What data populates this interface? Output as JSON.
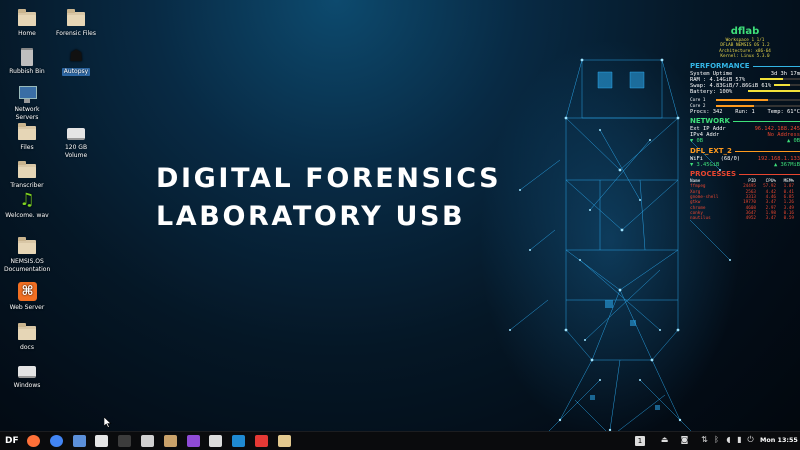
{
  "desktop": {
    "icons": [
      {
        "label": "Home",
        "type": "folder"
      },
      {
        "label": "Forensic Files",
        "type": "folder"
      },
      {
        "label": "Rubbish Bin",
        "type": "trash"
      },
      {
        "label": "Autopsy",
        "type": "app",
        "selected": true
      },
      {
        "label": "Network Servers",
        "type": "network"
      },
      {
        "label": "Files",
        "type": "folder"
      },
      {
        "label": "120 GB Volume",
        "type": "drive"
      },
      {
        "label": "Transcriber",
        "type": "folder"
      },
      {
        "label": "Welcome. wav",
        "type": "audio"
      },
      {
        "label": "NEMSIS.OS Documentation",
        "type": "folder"
      },
      {
        "label": "Web Server",
        "type": "xampp"
      },
      {
        "label": "docs",
        "type": "folder"
      },
      {
        "label": "Windows",
        "type": "drive"
      }
    ]
  },
  "wallpaper": {
    "headline_line1": "DIGITAL FORENSICS",
    "headline_line2": "LABORATORY USB",
    "accent": "#2fb6ff"
  },
  "conky": {
    "title": "dflab",
    "workspace": "Workspace 1 1/1",
    "os": "DFLAB NEMSIS OS 1.2",
    "arch": "Architecture: x86-64",
    "kernel": "Kernel: Linux 5.3.0",
    "performance": {
      "header": "PERFORMANCE",
      "uptime_label": "System Uptime",
      "uptime_value": "3d 3h 17m",
      "ram_label": "RAM : 4.14GiB 57%",
      "ram_pct": 57,
      "swap_label": "Swap: 4.83GiB/7.86GiB 61%",
      "swap_pct": 61,
      "battery_label": "Battery: 100%",
      "battery_pct": 100,
      "core1_label": "Core 1",
      "core1_pct": 62,
      "core2_label": "Core 2",
      "core2_pct": 45,
      "procs": "Procs: 342",
      "run": "Run: 1",
      "temp": "Temp: 61°C"
    },
    "network": {
      "header": "NETWORK",
      "ext_ip_label": "Ext IP Addr",
      "ext_ip_value": "96.142.188.245",
      "ipv4_label": "IPv4 Addr",
      "ipv4_value": "No Address",
      "down": "▼ 0B",
      "up": "▲ 0B"
    },
    "ext": {
      "header": "DFL_EXT_2",
      "wifi_label": "WiFi",
      "wifi_quality": "(68/0)",
      "wifi_ip": "192.168.1.133",
      "down": "▼ 3.45GiB",
      "up": "▲ 367MiB"
    },
    "processes": {
      "header": "PROCESSES",
      "columns": [
        "Name",
        "PID",
        "CPU%",
        "MEM%"
      ],
      "rows": [
        [
          "ffmpeg",
          "24495",
          "57.92",
          "1.87"
        ],
        [
          "Xorg",
          "2563",
          "4.42",
          "0.41"
        ],
        [
          "gnome-shell",
          "3313",
          "4.46",
          "6.85"
        ],
        [
          "gtkw",
          "19770",
          "3.47",
          "1.26"
        ],
        [
          "chrome",
          "4608",
          "2.97",
          "3.49"
        ],
        [
          "conky",
          "3647",
          "1.98",
          "0.16"
        ],
        [
          "nautilus",
          "4952",
          "3.47",
          "0.59"
        ]
      ]
    },
    "colors": {
      "green": "#3ee07a",
      "blue": "#33b5e5",
      "orange": "#ff9a1e",
      "red": "#e8452f",
      "yellow": "#f2e23a"
    }
  },
  "taskbar": {
    "start_label": "DF",
    "apps": [
      "firefox-icon",
      "chrome-icon",
      "files-icon",
      "store-icon",
      "terminal-icon",
      "drive-icon",
      "archive-icon",
      "shield-icon",
      "disk-icon",
      "vscode-icon",
      "dice-icon",
      "folder-icon"
    ],
    "workspace_indicator": "1",
    "clock": "Mon 13:55"
  }
}
